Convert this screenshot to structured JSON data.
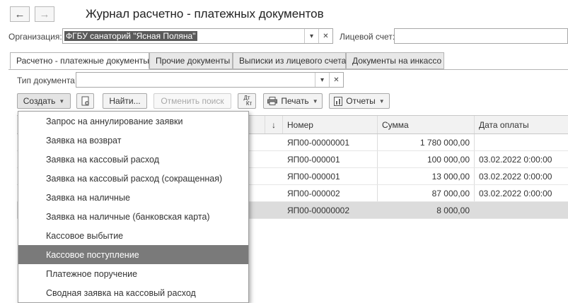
{
  "header": {
    "back_icon": "arrow-left-icon",
    "forward_icon": "arrow-right-icon",
    "title": "Журнал расчетно - платежных документов"
  },
  "filters": {
    "org_label": "Организация:",
    "org_value": "ФГБУ санаторий \"Ясная Поляна\"",
    "account_label": "Лицевой счет:",
    "account_value": "",
    "doctype_label": "Тип документа:",
    "doctype_value": ""
  },
  "tabs": [
    {
      "label": "Расчетно - платежные документы",
      "active": true
    },
    {
      "label": "Прочие документы",
      "active": false
    },
    {
      "label": "Выписки из лицевого счета",
      "active": false
    },
    {
      "label": "Документы на инкассо",
      "active": false
    }
  ],
  "toolbar": {
    "create_label": "Создать",
    "copy_icon": "copy-add-icon",
    "find_label": "Найти...",
    "cancel_search_label": "Отменить поиск",
    "dtkt_label_top": "Дт",
    "dtkt_label_bottom": "Кт",
    "print_label": "Печать",
    "reports_label": "Отчеты",
    "print_icon": "printer-icon",
    "reports_icon": "report-icon"
  },
  "table": {
    "sort_indicator": "↓",
    "columns": [
      "Номер",
      "Сумма",
      "Дата оплаты"
    ],
    "rows": [
      {
        "number": "ЯП00-00000001",
        "amount": "1 780 000,00",
        "date": ""
      },
      {
        "number": "ЯП00-000001",
        "amount": "100 000,00",
        "date": "03.02.2022 0:00:00"
      },
      {
        "number": "ЯП00-000001",
        "amount": "13 000,00",
        "date": "03.02.2022 0:00:00"
      },
      {
        "number": "ЯП00-000002",
        "amount": "87 000,00",
        "date": "03.02.2022 0:00:00"
      },
      {
        "number": "ЯП00-00000002",
        "amount": "8 000,00",
        "date": ""
      }
    ]
  },
  "create_menu": {
    "items": [
      "Запрос на аннулирование заявки",
      "Заявка на возврат",
      "Заявка на кассовый расход",
      "Заявка на кассовый расход (сокращенная)",
      "Заявка на наличные",
      "Заявка на наличные (банковская карта)",
      "Кассовое выбытие",
      "Кассовое поступление",
      "Платежное поручение",
      "Сводная заявка на кассовый расход"
    ],
    "highlighted_index": 7
  }
}
